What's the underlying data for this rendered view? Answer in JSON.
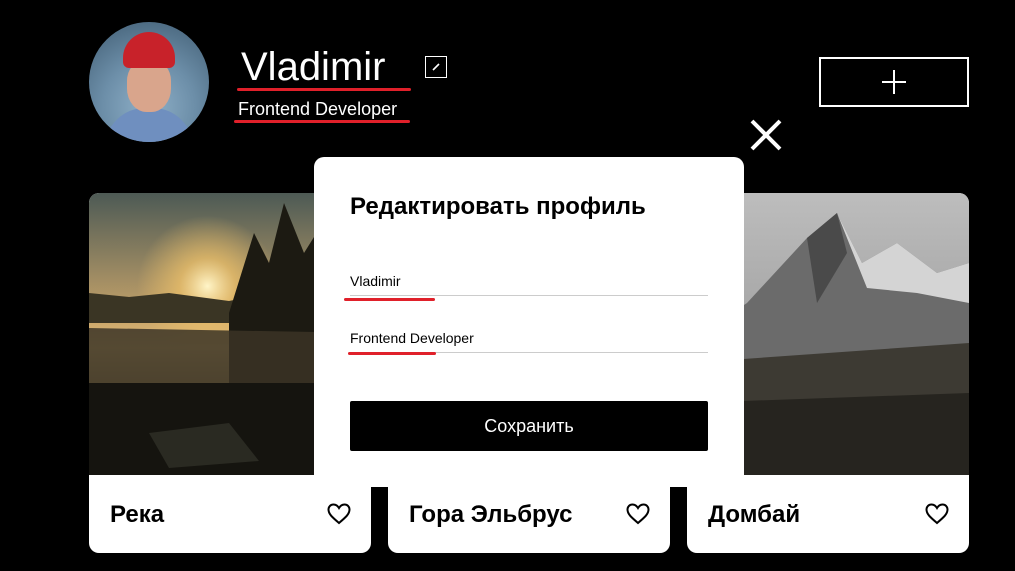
{
  "profile": {
    "name": "Vladimir",
    "job": "Frontend Developer",
    "avatar_icon": "person-avatar"
  },
  "icons": {
    "edit": "edit-pencil-icon",
    "add": "plus-icon",
    "close": "close-icon",
    "like": "heart-icon"
  },
  "cards": [
    {
      "title": "Река"
    },
    {
      "title": "Гора Эльбрус"
    },
    {
      "title": "Домбай"
    }
  ],
  "popup": {
    "title": "Редактировать профиль",
    "name_value": "Vladimir",
    "job_value": "Frontend Developer",
    "save_label": "Сохранить"
  },
  "colors": {
    "page_background": "#000000",
    "card_background": "#ffffff",
    "accent_underline": "#e0202a"
  }
}
